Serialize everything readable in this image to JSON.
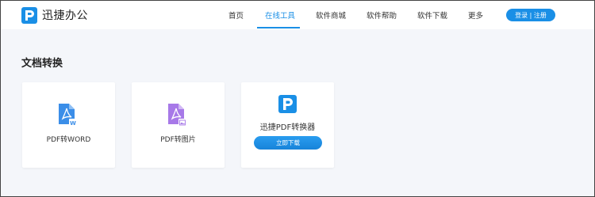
{
  "brand": {
    "name": "迅捷办公"
  },
  "nav": {
    "items": [
      {
        "label": "首页"
      },
      {
        "label": "在线工具"
      },
      {
        "label": "软件商城"
      },
      {
        "label": "软件帮助"
      },
      {
        "label": "软件下载"
      },
      {
        "label": "更多"
      }
    ],
    "active_index": 1,
    "login_label": "登录 | 注册"
  },
  "section": {
    "title": "文档转换"
  },
  "cards": [
    {
      "label": "PDF转WORD",
      "icon": "pdf-to-word-icon"
    },
    {
      "label": "PDF转图片",
      "icon": "pdf-to-image-icon"
    },
    {
      "label": "迅捷PDF转换器",
      "icon": "xunjie-pdf-logo-icon",
      "button_label": "立即下载"
    }
  ],
  "colors": {
    "accent": "#1a8fe6",
    "word_icon": "#3b8ee8",
    "image_icon": "#a779e8",
    "background": "#f4f6fa"
  }
}
